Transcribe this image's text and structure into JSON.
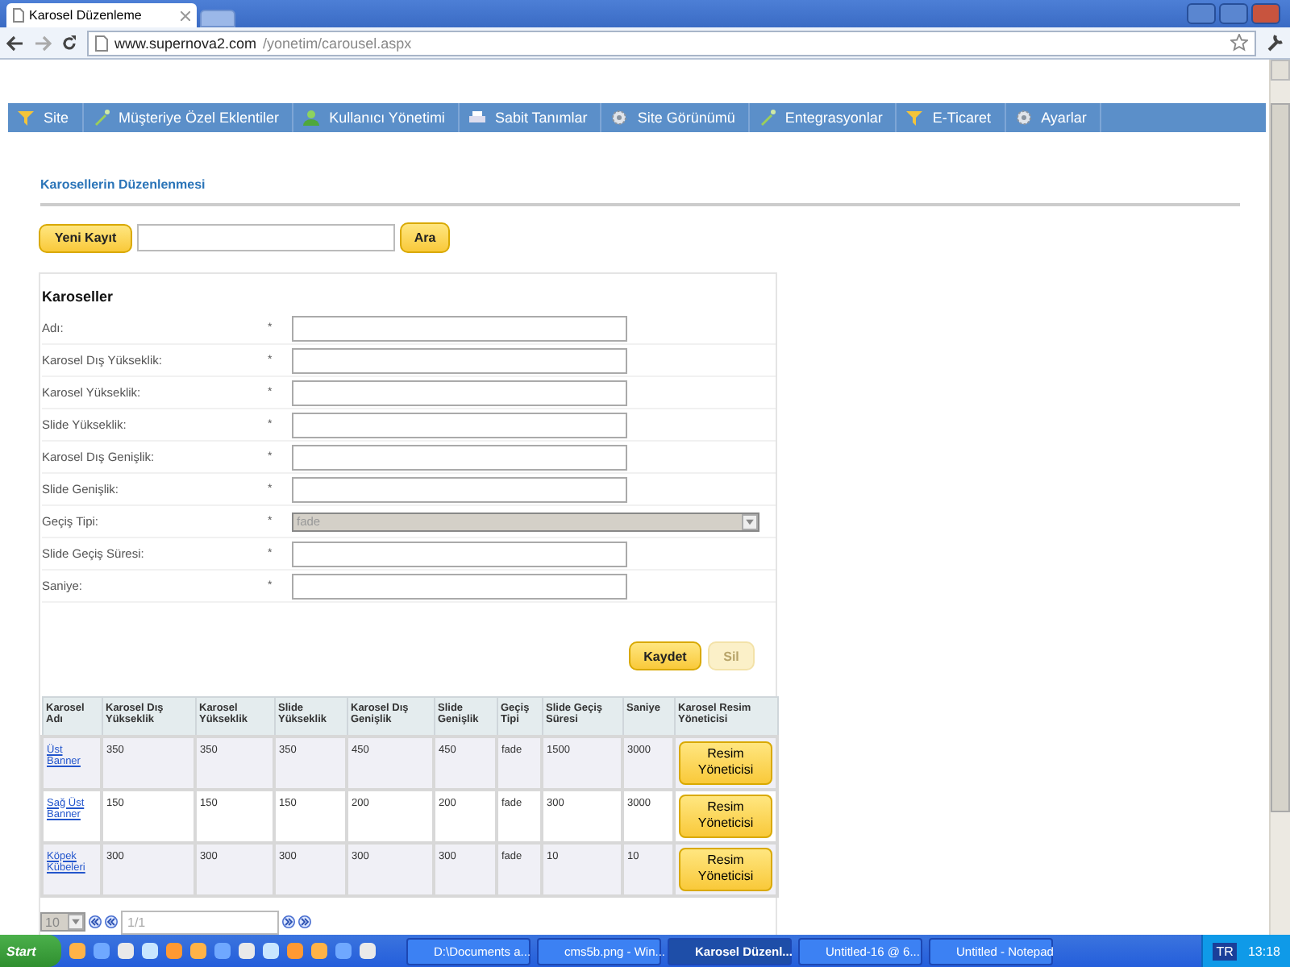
{
  "browser": {
    "tab_title": "Karosel Düzenleme",
    "url_host": "www.supernova2.com",
    "url_path": "/yonetim/carousel.aspx"
  },
  "nav": [
    {
      "label": "Site"
    },
    {
      "label": "Müşteriye Özel Eklentiler"
    },
    {
      "label": "Kullanıcı Yönetimi"
    },
    {
      "label": "Sabit Tanımlar"
    },
    {
      "label": "Site Görünümü"
    },
    {
      "label": "Entegrasyonlar"
    },
    {
      "label": "E-Ticaret"
    },
    {
      "label": "Ayarlar"
    }
  ],
  "page_title": "Karosellerin Düzenlenmesi",
  "toolbar": {
    "new_button": "Yeni Kayıt",
    "search_button": "Ara"
  },
  "form": {
    "title": "Karoseller",
    "fields": [
      {
        "label": "Adı:",
        "required": "*",
        "kind": "text"
      },
      {
        "label": "Karosel Dış Yükseklik:",
        "required": "*",
        "kind": "text"
      },
      {
        "label": "Karosel Yükseklik:",
        "required": "*",
        "kind": "text"
      },
      {
        "label": "Slide Yükseklik:",
        "required": "*",
        "kind": "text"
      },
      {
        "label": "Karosel Dış Genişlik:",
        "required": "*",
        "kind": "text"
      },
      {
        "label": "Slide Genişlik:",
        "required": "*",
        "kind": "text"
      },
      {
        "label": "Geçiş Tipi:",
        "required": "*",
        "kind": "select",
        "value": "fade",
        "disabled": true
      },
      {
        "label": "Slide Geçiş Süresi:",
        "required": "*",
        "kind": "text"
      },
      {
        "label": "Saniye:",
        "required": "*",
        "kind": "text"
      }
    ],
    "save_button": {
      "label": "Kaydet",
      "disabled": false
    },
    "delete_button": {
      "label": "Sil",
      "disabled": true
    }
  },
  "table": {
    "columns": [
      "Karosel Adı",
      "Karosel Dış Yükseklik",
      "Karosel Yükseklik",
      "Slide Yükseklik",
      "Karosel Dış Genişlik",
      "Slide Genişlik",
      "Geçiş Tipi",
      "Slide Geçiş Süresi",
      "Saniye",
      "Karosel Resim Yöneticisi"
    ],
    "rows": [
      {
        "cells": [
          "Üst Banner",
          "350",
          "350",
          "350",
          "450",
          "450",
          "fade",
          "1500",
          "3000"
        ],
        "action": "Resim Yöneticisi"
      },
      {
        "cells": [
          "Sağ Üst Banner",
          "150",
          "150",
          "150",
          "200",
          "200",
          "fade",
          "300",
          "3000"
        ],
        "action": "Resim Yöneticisi"
      },
      {
        "cells": [
          "Köpek Kübeleri",
          "300",
          "300",
          "300",
          "300",
          "300",
          "fade",
          "10",
          "10"
        ],
        "action": "Resim Yöneticisi"
      }
    ]
  },
  "pager": {
    "page_size": "10",
    "page_text": "1/1"
  },
  "taskbar": {
    "start": "Start",
    "tasks": [
      {
        "label": "D:\\Documents a...",
        "selected": false
      },
      {
        "label": "cms5b.png - Win...",
        "selected": false
      },
      {
        "label": "Karosel Düzenl...",
        "selected": true
      },
      {
        "label": "Untitled-16 @ 6...",
        "selected": false
      },
      {
        "label": "Untitled - Notepad",
        "selected": false
      }
    ],
    "lang": "TR",
    "clock": "13:18"
  }
}
